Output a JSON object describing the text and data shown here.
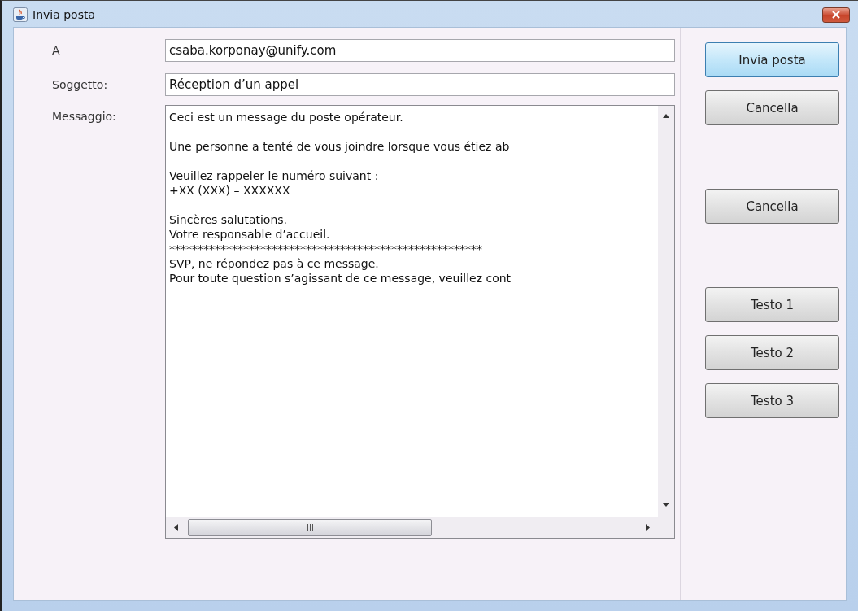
{
  "window": {
    "title": "Invia posta"
  },
  "fields": [
    {
      "label": "A",
      "value": "csaba.korponay@unify.com"
    },
    {
      "label": "Soggetto:",
      "value": "Réception d’un appel"
    }
  ],
  "message": {
    "label": "Messaggio:",
    "paragraphs": [
      [
        "Ceci est un message du poste opérateur."
      ],
      [
        "Une personne a tenté de vous joindre lorsque vous étiez ab"
      ],
      [
        "Veuillez rappeler le numéro suivant :",
        "+XX (XXX) – XXXXXX"
      ],
      [
        "Sincères salutations.",
        "Votre responsable d’accueil.",
        "*******************************************************",
        "SVP, ne répondez pas à ce message.",
        "Pour toute question s’agissant de ce message, veuillez cont"
      ]
    ]
  },
  "button_groups": [
    [
      {
        "label": "Invia posta",
        "focused": true
      },
      {
        "label": "Cancella",
        "focused": false
      }
    ],
    [
      {
        "label": "Cancella",
        "focused": false
      }
    ],
    [
      {
        "label": "Testo 1",
        "focused": false
      },
      {
        "label": "Testo 2",
        "focused": false
      },
      {
        "label": "Testo 3",
        "focused": false
      }
    ]
  ]
}
